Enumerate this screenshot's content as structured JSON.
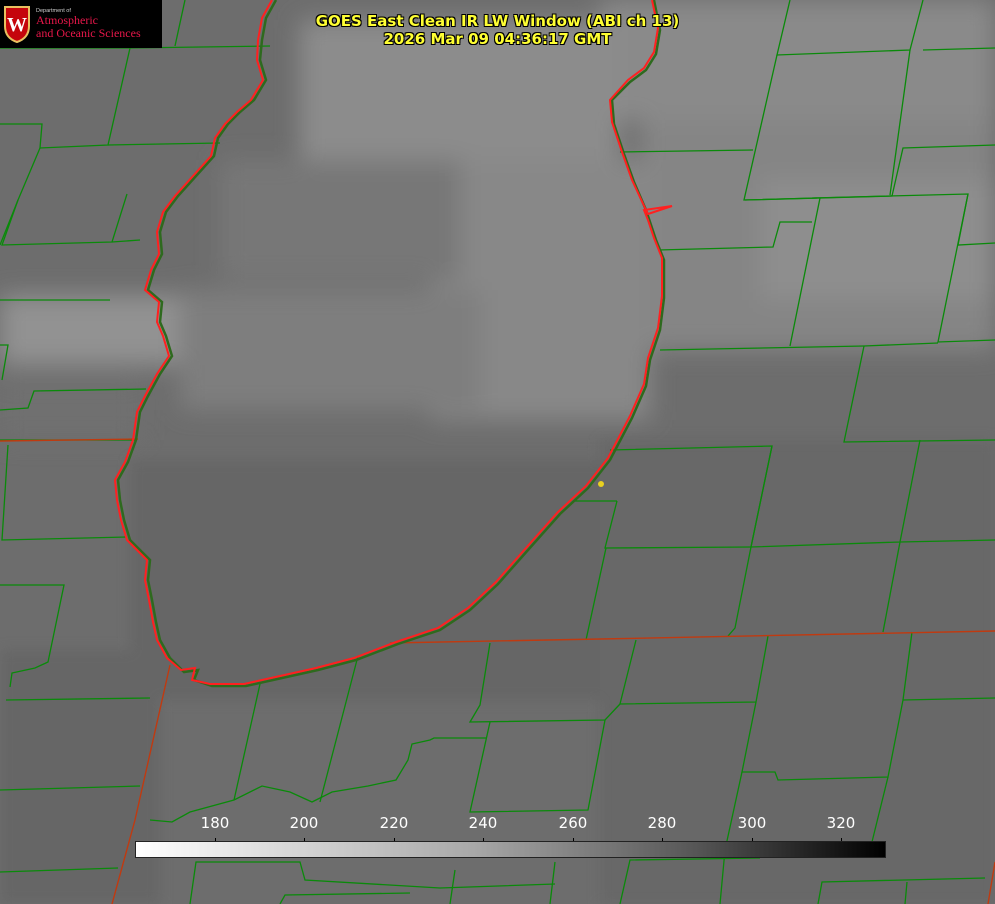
{
  "title": {
    "line1": "GOES East Clean IR LW Window (ABI ch 13)",
    "line2": "2026 Mar 09 04:36:17 GMT"
  },
  "logo": {
    "emblem_letter": "W",
    "dept": "Department of",
    "line1": "Atmospheric",
    "line2": "and Oceanic Sciences"
  },
  "colorbar": {
    "tick_labels": [
      "180",
      "200",
      "220",
      "240",
      "260",
      "280",
      "300",
      "320"
    ],
    "gradient": [
      "#ffffff",
      "#a8a8a8",
      "#555555",
      "#000000"
    ]
  },
  "colors": {
    "county_lines": "#0a8a0a",
    "lake_outline": "#ff2020",
    "state_lines": "#c03010",
    "marker": "#e8d020",
    "title_text": "#ffff33"
  }
}
